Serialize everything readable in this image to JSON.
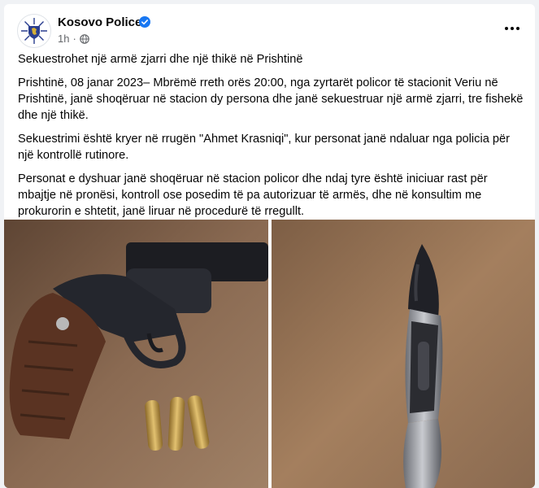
{
  "post": {
    "author": "Kosovo Police",
    "time": "1h",
    "title": "Sekuestrohet një armë zjarri dhe një thikë në Prishtinë",
    "paragraphs": [
      "Prishtinë, 08 janar 2023– Mbrëmë rreth orës 20:00,  nga zyrtarët policor të stacionit Veriu në Prishtinë, janë shoqëruar në stacion dy persona dhe janë sekuestruar një armë zjarri, tre fishekë dhe një thikë.",
      "Sekuestrimi është kryer në rrugën \"Ahmet Krasniqi\", kur personat janë ndaluar nga policia për një kontrollë rutinore.",
      "Personat e dyshuar janë shoqëruar në stacion policor dhe ndaj tyre është iniciuar rast për mbajtje në pronësi, kontroll ose posedim të pa autorizuar të armës, dhe në konsultim me prokurorin e shtetit,  janë liruar në procedurë të rregullt."
    ]
  },
  "icons": {
    "verified": "verified-badge-icon",
    "privacy": "globe-icon",
    "more": "more-options-icon"
  },
  "colors": {
    "verified": "#1877f2",
    "meta": "#65676b",
    "background": "#f0f2f5"
  }
}
